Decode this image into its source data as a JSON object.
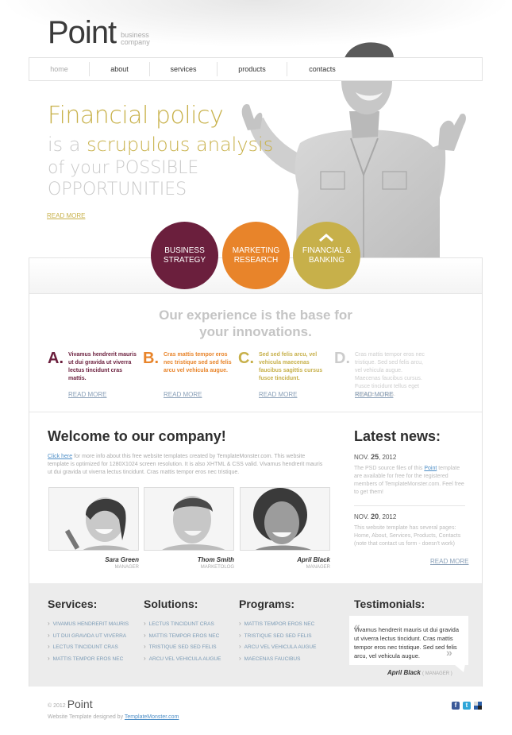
{
  "logo": {
    "word": "Point",
    "tagline_1": "business",
    "tagline_2": "company"
  },
  "nav": {
    "items": [
      "home",
      "about",
      "services",
      "products",
      "contacts"
    ]
  },
  "hero": {
    "line1": "Financial policy",
    "line2_prefix": "is a ",
    "line2_accent": "scrupulous analysis",
    "line3": "of your POSSIBLE",
    "line4": "OPPORTUNITIES",
    "read_more": "READ MORE"
  },
  "circles": [
    {
      "line1": "BUSINESS",
      "line2": "STRATEGY",
      "color": "#6b1f3d"
    },
    {
      "line1": "MARKETING",
      "line2": "RESEARCH",
      "color": "#e8842a"
    },
    {
      "line1": "FINANCIAL &",
      "line2": "BANKING",
      "color": "#c7b04a"
    }
  ],
  "experience": {
    "title_1": "Our experience is the base for",
    "title_2": "your innovations.",
    "features": [
      {
        "letter": "A.",
        "text": "Vivamus hendrerit mauris ut dui gravida ut viverra lectus tincidunt cras mattis.",
        "color": "#6b1f3d",
        "more": "READ MORE"
      },
      {
        "letter": "B.",
        "text": "Cras mattis tempor eros nec tristique sed sed felis arcu vel vehicula augue.",
        "color": "#e8842a",
        "more": "READ MORE"
      },
      {
        "letter": "C.",
        "text": "Sed sed felis arcu, vel vehicula maecenas faucibus sagittis cursus fusce tincidunt.",
        "color": "#c7b04a",
        "more": "READ MORE"
      },
      {
        "letter": "D.",
        "text": "Cras mattis tempor eros nec tristique. Sed sed felis arcu, vel vehicula augue. Maecenas faucibus cursus. Fusce tincidunt tellus eget tristique, cursus.",
        "color": "#cccccc",
        "more": "READ MORE"
      }
    ]
  },
  "welcome": {
    "title": "Welcome to our company!",
    "link": "Click here",
    "text": " for more info about this free website templates created by TemplateMonster.com. This website template is optimized for 1280X1024 screen resolution. It is also XHTML & CSS valid. Vivamus hendrerit mauris ut dui gravida ut viverra lectus tincidunt. Cras mattis tempor eros nec tristique.",
    "people": [
      {
        "name": "Sara Green",
        "role": "MANAGER"
      },
      {
        "name": "Thom Smith",
        "role": "MARKETOLOG"
      },
      {
        "name": "April Black",
        "role": "MANAGER"
      }
    ]
  },
  "news": {
    "title": "Latest news:",
    "items": [
      {
        "month": "NOV.",
        "day": "25",
        "year": ", 2012",
        "pre": "The PSD source files of this ",
        "link": "Point",
        "post": " template are available for free for the registered members of TemplateMonster.com. Feel free to get them!"
      },
      {
        "month": "NOV.",
        "day": "20",
        "year": ", 2012",
        "pre": "This website template has several pages: Home, About, Services, Products, Contacts (note that contact us form - doesn't work)",
        "link": "",
        "post": ""
      }
    ],
    "read_more": "READ MORE"
  },
  "columns": {
    "services": {
      "title": "Services:",
      "items": [
        "VIVAMUS HENDRERIT MAURIS",
        "UT DUI GRAVIDA UT VIVERRA",
        "LECTUS TINCIDUNT CRAS",
        "MATTIS TEMPOR EROS NEC"
      ]
    },
    "solutions": {
      "title": "Solutions:",
      "items": [
        "LECTUS TINCIDUNT CRAS",
        "MATTIS TEMPOR EROS NEC",
        "TRISTIQUE SED SED FELIS",
        "ARCU VEL VEHICULA AUGUE"
      ]
    },
    "programs": {
      "title": "Programs:",
      "items": [
        "MATTIS TEMPOR EROS NEC",
        "TRISTIQUE SED SED FELIS",
        "ARCU VEL VEHICULA AUGUE",
        "MAECENAS FAUCIBUS"
      ]
    }
  },
  "testimonials": {
    "title": "Testimonials:",
    "text": "Vivamus hendrerit mauris ut dui gravida ut viverra lectus tincidunt. Cras mattis tempor eros nec tristique. Sed sed felis arcu, vel vehicula augue.",
    "name": "April Black",
    "role": "( MANAGER )"
  },
  "footer": {
    "year": "© 2012",
    "logo": "Point",
    "credit": "Website Template designed by ",
    "credit_link": "TemplateMonster.com"
  },
  "social": [
    {
      "name": "facebook-icon",
      "glyph": "f",
      "color": "#3b5998"
    },
    {
      "name": "twitter-icon",
      "glyph": "t",
      "color": "#2fa6d8"
    },
    {
      "name": "delicious-icon",
      "glyph": "",
      "color": "#2b5fa8"
    }
  ]
}
